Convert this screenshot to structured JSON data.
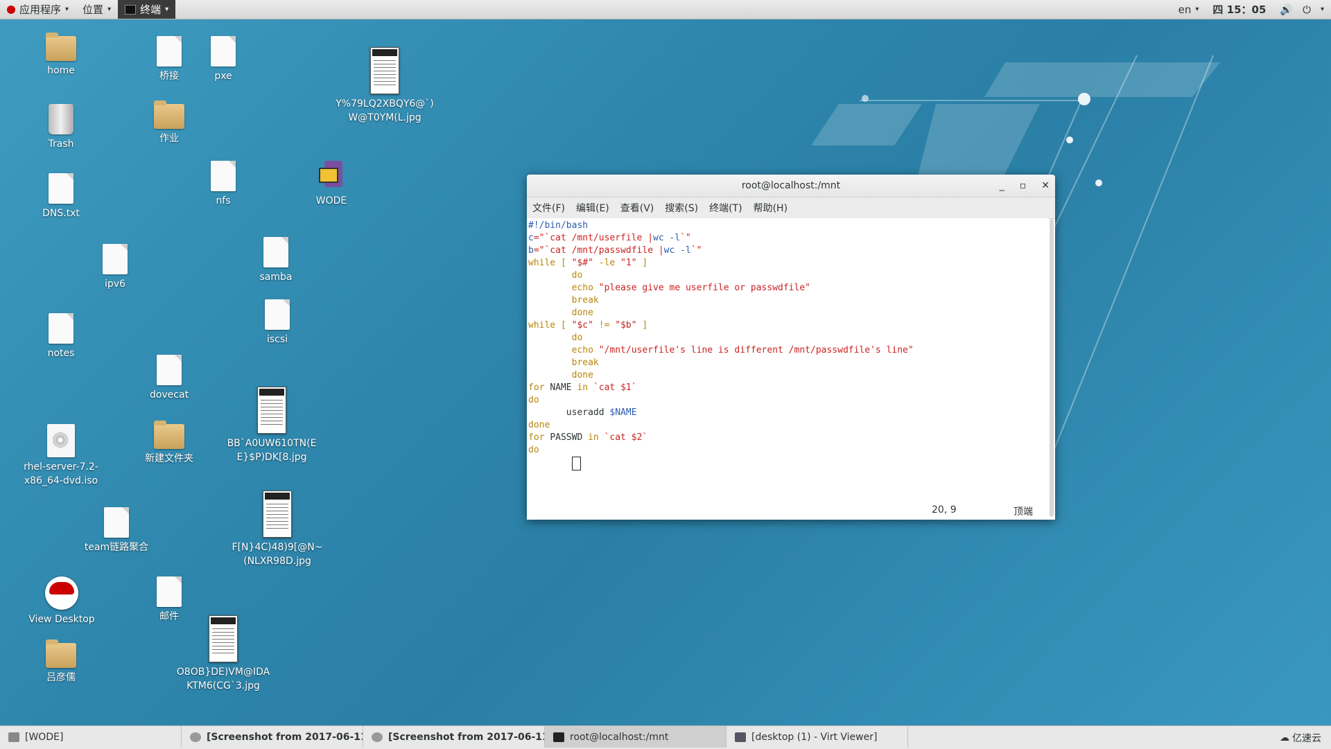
{
  "topbar": {
    "apps_label": "应用程序",
    "places_label": "位置",
    "active_app_label": "终端",
    "lang": "en",
    "clock": "四 15：05"
  },
  "desktop_icons": [
    {
      "label": "home"
    },
    {
      "label": "桥接"
    },
    {
      "label": "pxe"
    },
    {
      "label": "Y%79LQ2XBQY6@`)W@T0YM(L.jpg"
    },
    {
      "label": "Trash"
    },
    {
      "label": "作业"
    },
    {
      "label": "DNS.txt"
    },
    {
      "label": "nfs"
    },
    {
      "label": "WODE"
    },
    {
      "label": "ipv6"
    },
    {
      "label": "samba"
    },
    {
      "label": "notes"
    },
    {
      "label": "iscsi"
    },
    {
      "label": "dovecat"
    },
    {
      "label": "BB`A0UW610TN(EE}$P)DK[8.jpg"
    },
    {
      "label": "rhel-server-7.2-x86_64-dvd.iso"
    },
    {
      "label": "新建文件夹"
    },
    {
      "label": "team链路聚合"
    },
    {
      "label": "F[N}4C)48)9[@N~(NLXR98D.jpg"
    },
    {
      "label": "View Desktop"
    },
    {
      "label": "邮件"
    },
    {
      "label": "吕彦儒"
    },
    {
      "label": "O8OB}DE)VM@IDAKTM6(CG`3.jpg"
    }
  ],
  "terminal": {
    "title": "root@localhost:/mnt",
    "menu": [
      "文件(F)",
      "编辑(E)",
      "查看(V)",
      "搜索(S)",
      "终端(T)",
      "帮助(H)"
    ],
    "lines": [
      [
        {
          "t": "#!/bin/bash",
          "c": "c"
        }
      ],
      [
        {
          "t": "c",
          "c": "v"
        },
        {
          "t": "=\"`cat /mnt/userfile |",
          "c": "s"
        },
        {
          "t": "wc -l",
          "c": "v"
        },
        {
          "t": "`\"",
          "c": "s"
        }
      ],
      [
        {
          "t": "b",
          "c": "v"
        },
        {
          "t": "=\"`cat /mnt/passwdfile |",
          "c": "s"
        },
        {
          "t": "wc -l",
          "c": "v"
        },
        {
          "t": "`\"",
          "c": "s"
        }
      ],
      [
        {
          "t": "while [ ",
          "c": "k"
        },
        {
          "t": "\"$#\"",
          "c": "s"
        },
        {
          "t": " -le ",
          "c": "k"
        },
        {
          "t": "\"1\"",
          "c": "s"
        },
        {
          "t": " ]",
          "c": "k"
        }
      ],
      [
        {
          "t": "        do",
          "c": "k"
        }
      ],
      [
        {
          "t": "        echo ",
          "c": "k"
        },
        {
          "t": "\"please give me userfile or passwdfile\"",
          "c": "s"
        }
      ],
      [
        {
          "t": "        break",
          "c": "k"
        }
      ],
      [
        {
          "t": "        done",
          "c": "k"
        }
      ],
      [
        {
          "t": "while [ ",
          "c": "k"
        },
        {
          "t": "\"$c\"",
          "c": "s"
        },
        {
          "t": " != ",
          "c": "k"
        },
        {
          "t": "\"$b\"",
          "c": "s"
        },
        {
          "t": " ]",
          "c": "k"
        }
      ],
      [
        {
          "t": "        do",
          "c": "k"
        }
      ],
      [
        {
          "t": "        echo ",
          "c": "k"
        },
        {
          "t": "\"/mnt/userfile's line is different /mnt/passwdfile's line\"",
          "c": "s"
        }
      ],
      [
        {
          "t": "        break",
          "c": "k"
        }
      ],
      [
        {
          "t": "        done",
          "c": "k"
        }
      ],
      [
        {
          "t": "for ",
          "c": "k"
        },
        {
          "t": "NAME ",
          "c": ""
        },
        {
          "t": "in ",
          "c": "k"
        },
        {
          "t": "`cat $1`",
          "c": "s"
        }
      ],
      [
        {
          "t": "do",
          "c": "k"
        }
      ],
      [
        {
          "t": "       useradd ",
          "c": ""
        },
        {
          "t": "$NAME",
          "c": "v"
        }
      ],
      [
        {
          "t": "done",
          "c": "k"
        }
      ],
      [
        {
          "t": "for ",
          "c": "k"
        },
        {
          "t": "PASSWD ",
          "c": ""
        },
        {
          "t": "in ",
          "c": "k"
        },
        {
          "t": "`cat $2`",
          "c": "s"
        }
      ],
      [
        {
          "t": "do",
          "c": "k"
        }
      ]
    ],
    "status_position": "20, 9",
    "status_scroll": "顶端"
  },
  "taskbar": {
    "tasks": [
      {
        "label": "[WODE]"
      },
      {
        "label": "[Screenshot from 2017-06-11 …"
      },
      {
        "label": "[Screenshot from 2017-06-11 …"
      },
      {
        "label": "root@localhost:/mnt"
      },
      {
        "label": "[desktop (1) - Virt Viewer]"
      }
    ],
    "watermark": "亿速云"
  }
}
